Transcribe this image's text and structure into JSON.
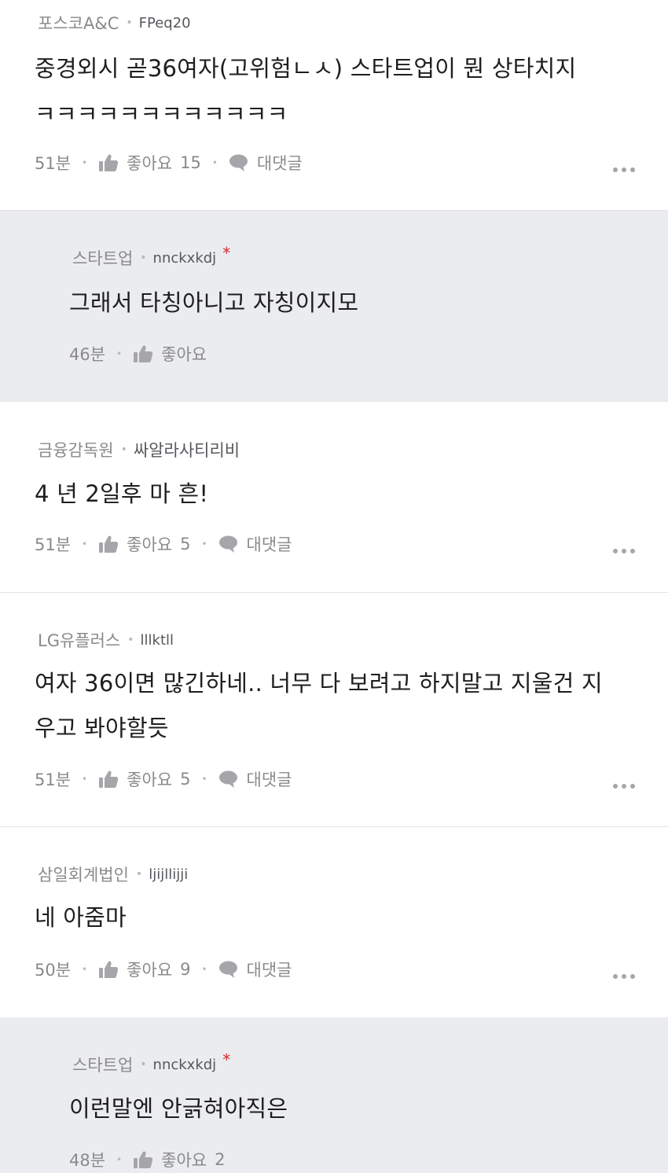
{
  "comments": [
    {
      "company": "포스코A&C",
      "nick": "FPeq20",
      "text_lines": [
        "중경외시 곧36여자(고위험ㄴㅅ) 스타트업이 뭔 상타치지",
        "ㅋㅋㅋㅋㅋㅋㅋㅋㅋㅋㅋㅋ"
      ],
      "time": "51분",
      "like_label": "좋아요",
      "like_count": "15",
      "reply_label": "대댓글"
    },
    {
      "company": "스타트업",
      "nick": "nnckxkdj",
      "op_mark": "*",
      "text_lines": [
        "그래서 타칭아니고 자칭이지모"
      ],
      "time": "46분",
      "like_label": "좋아요"
    },
    {
      "company": "금융감독원",
      "nick": "싸알라사티리비",
      "text_lines": [
        "4 년 2일후 마 흔!"
      ],
      "time": "51분",
      "like_label": "좋아요",
      "like_count": "5",
      "reply_label": "대댓글"
    },
    {
      "company": "LG유플러스",
      "nick": "lllktll",
      "text_lines": [
        "여자 36이면 많긴하네.. 너무 다 보려고 하지말고 지울건 지",
        "우고 봐야할듯"
      ],
      "time": "51분",
      "like_label": "좋아요",
      "like_count": "5",
      "reply_label": "대댓글"
    },
    {
      "company": "삼일회계법인",
      "nick": "ljijllijji",
      "text_lines": [
        "네 아줌마"
      ],
      "time": "50분",
      "like_label": "좋아요",
      "like_count": "9",
      "reply_label": "대댓글"
    },
    {
      "company": "스타트업",
      "nick": "nnckxkdj",
      "op_mark": "*",
      "text_lines": [
        "이런말엔 안긁혀아직은"
      ],
      "time": "48분",
      "like_label": "좋아요",
      "like_count": "2"
    }
  ],
  "icons": {
    "like": "thumbs-up-icon",
    "reply": "speech-bubble-icon",
    "more": "more-dots-icon"
  },
  "colors": {
    "reply_background": "#ebecef",
    "op_marker": "#d8262f",
    "meta_text": "#8a8a8e"
  }
}
